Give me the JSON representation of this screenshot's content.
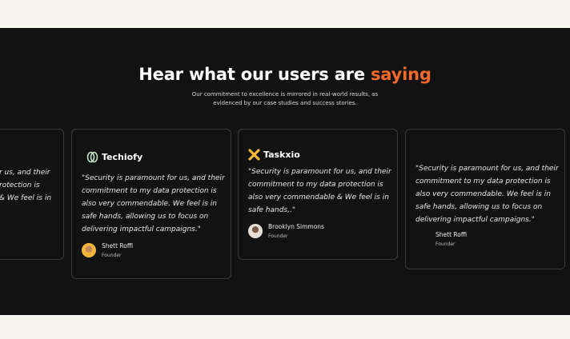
{
  "section": {
    "title_main": "Hear what our users are ",
    "title_accent": "saying",
    "subtitle": "Our commitment to excellence is mirrored in real-world results, as evidenced by our case studies and success stories.",
    "accent_color": "#f26a2b",
    "background_color": "#121212"
  },
  "testimonials": [
    {
      "quote": "r us, and their\nrotection is\n& We feel  is in",
      "icon": "none"
    },
    {
      "brand": "Techiofy",
      "icon": "techiofy-logo-icon",
      "quote": "\"Security is paramount for us, and their commitment to my data protection is also very commendable. We feel  is in safe hands, allowing us to focus on delivering impactful campaigns.\"",
      "author_name": "Shett Roffi",
      "author_role": "Founder"
    },
    {
      "brand": "Taskxio",
      "icon": "taskxio-logo-icon",
      "quote": "\"Security is paramount for us, and their commitment to my data protection is also very commendable & We feel  is in safe hands,.\"",
      "author_name": "Brooklyn Simmons",
      "author_role": "Founder"
    },
    {
      "quote": "\"Security is paramount for us, and their commitment to my data protection is also very commendable. We feel  is in safe hands, allowing us to focus on delivering impactful campaigns.\"",
      "author_name": "Shett Roffi",
      "author_role": "Founder"
    }
  ]
}
